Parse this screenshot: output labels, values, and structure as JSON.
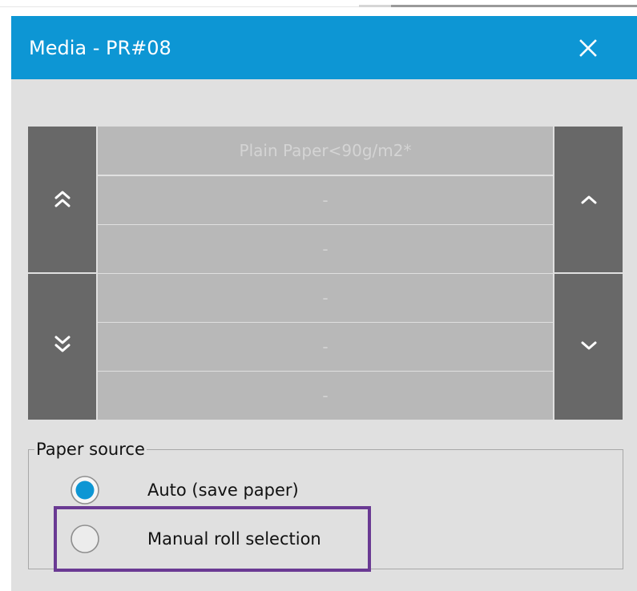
{
  "dialog": {
    "title": "Media - PR#08",
    "close_icon": "close-icon"
  },
  "colors": {
    "titlebar": "#0d96d4",
    "dialog_bg": "#e0e0e0",
    "nav_button": "#686868",
    "row_bg": "#b8b8b8",
    "row_text": "#d4d4d4",
    "radio_selected": "#0d96d4",
    "highlight": "#6a3a93"
  },
  "navigation": {
    "page_up_icon": "double-chevron-up-icon",
    "page_down_icon": "double-chevron-down-icon",
    "scroll_up_icon": "chevron-up-icon",
    "scroll_down_icon": "chevron-down-icon"
  },
  "media_list": {
    "items": [
      "Plain Paper<90g/m2*",
      "-",
      "-",
      "-",
      "-",
      "-"
    ]
  },
  "paper_source": {
    "legend": "Paper source",
    "selected": "auto",
    "options": [
      {
        "id": "auto",
        "label": "Auto (save paper)",
        "checked": true
      },
      {
        "id": "manual",
        "label": "Manual roll selection",
        "checked": false
      }
    ]
  }
}
